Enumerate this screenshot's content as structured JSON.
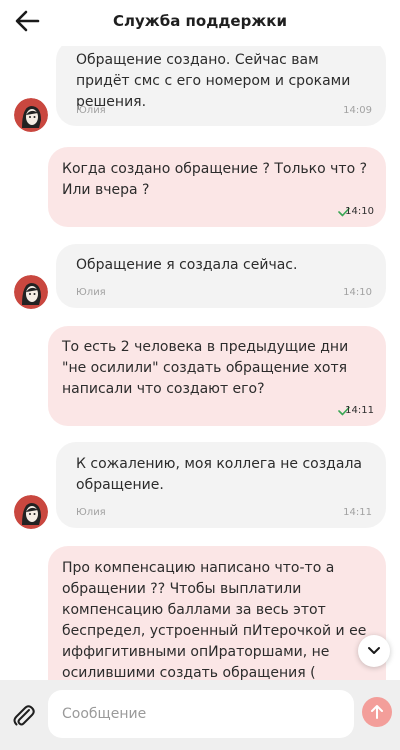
{
  "header": {
    "title": "Служба поддержки",
    "back_icon": "arrow-left-icon"
  },
  "messages": [
    {
      "direction": "incoming",
      "text": "Обращение создано. Сейчас вам придёт смс с его номером и сроками решения.",
      "author": "Юлия",
      "time": "14:09"
    },
    {
      "direction": "outgoing",
      "text": "Когда создано обращение ? Только что ? Или вчера ?",
      "time": "14:10",
      "status": "delivered"
    },
    {
      "direction": "incoming",
      "text": "Обращение я создала сейчас.",
      "author": "Юлия",
      "time": "14:10"
    },
    {
      "direction": "outgoing",
      "text": "То есть 2 человека в предыдущие дни \"не осилили\" создать обращение хотя написали что создают его?",
      "time": "14:11",
      "status": "delivered"
    },
    {
      "direction": "incoming",
      "text": "К сожалению, моя коллега не создала обращение.",
      "author": "Юлия",
      "time": "14:11"
    },
    {
      "direction": "outgoing",
      "text": "Про компенсацию написано что-то а обращении ?? Чтобы выплатили компенсацию баллами за весь этот беспредел, устроенный пИтерочкой и ее иффигитивными опИраторшами, не осилившими создать обращения ("
    }
  ],
  "composer": {
    "placeholder": "Сообщение",
    "value": "",
    "attach_icon": "paperclip-icon",
    "send_icon": "arrow-up-icon"
  },
  "scroll_down_icon": "chevron-down-icon",
  "colors": {
    "incoming_bubble": "#f3f3f3",
    "outgoing_bubble": "#fbe6e6",
    "send_button": "#f39e9a",
    "check": "#3aa655",
    "composer_bg": "#efefef"
  }
}
